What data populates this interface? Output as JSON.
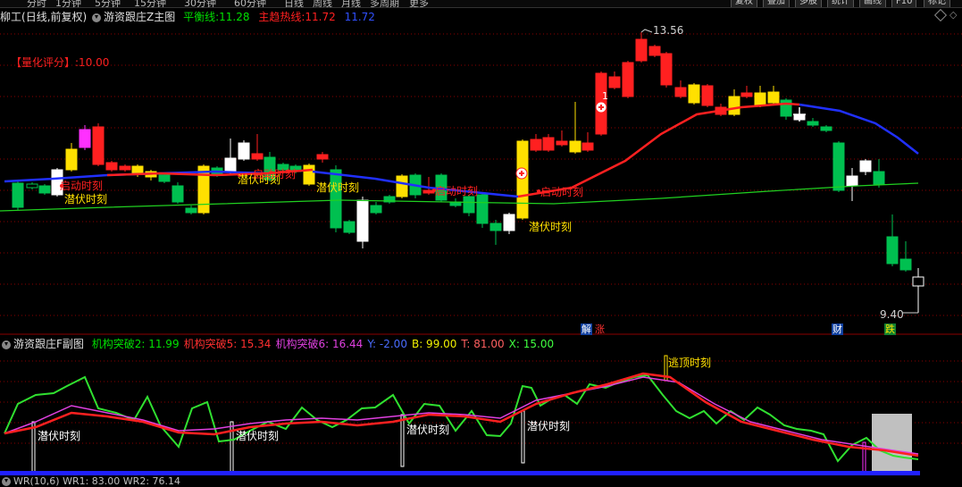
{
  "toolbar": {
    "periods": [
      "分时",
      "1分钟",
      "5分钟",
      "15分钟",
      "30分钟",
      "60分钟",
      "日线",
      "周线",
      "月线",
      "多周期",
      "更多"
    ],
    "buttons": [
      "复权",
      "叠加",
      "多股",
      "统计",
      "画线",
      "F10",
      "标记"
    ]
  },
  "main_panel": {
    "stock_name": "柳工",
    "mode": "(日线,前复权)",
    "indicator": "游资跟庄Z主图",
    "balance_label": "平衡线:",
    "balance_value": "11.28",
    "hot_label": "主趋热线:",
    "hot_value": "11.72",
    "extra_value": "11.72",
    "score_label": "【量化评分】",
    "score_value": ":10.00",
    "high_price": "13.56",
    "low_price": "9.40",
    "marker_one": "1",
    "badges": {
      "jie": "解",
      "zhang": "涨",
      "cai": "财",
      "die": "跌"
    }
  },
  "signals": {
    "qianfu": "潜伏时刻",
    "qidong": "启动时刻",
    "taoding": "逃顶时刻"
  },
  "sub_panel": {
    "indicator": "游资跟庄F副图",
    "fields": [
      {
        "label": "机构突破2:",
        "value": "11.99",
        "color": "#00e000"
      },
      {
        "label": "机构突破5:",
        "value": "15.34",
        "color": "#ff3030"
      },
      {
        "label": "机构突破6:",
        "value": "16.44",
        "color": "#e040e0"
      },
      {
        "label": "Y:",
        "value": "-2.00",
        "color": "#4a6cff"
      },
      {
        "label": "B:",
        "value": "99.00",
        "color": "#f0f000"
      },
      {
        "label": "T:",
        "value": "81.00",
        "color": "#ff6060"
      },
      {
        "label": "X:",
        "value": "15.00",
        "color": "#40ff40"
      }
    ]
  },
  "bottom_panel": {
    "text": "WR(10,6)  WR1: 83.00  WR2: 76.14"
  },
  "colors": {
    "up": "#ff2020",
    "down": "#00c050",
    "yellow": "#ffe000",
    "magenta": "#ff30ff",
    "white": "#ffffff",
    "blue": "#2020ff"
  }
}
